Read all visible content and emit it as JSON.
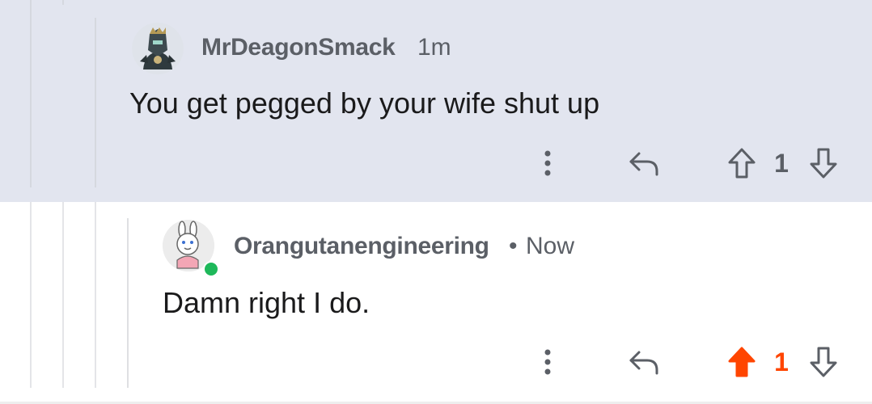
{
  "comments": [
    {
      "username": "MrDeagonSmack",
      "time": "1m",
      "body": "You get pegged by your wife shut up",
      "score": "1",
      "upvoted": false,
      "avatar_icon": "knight-avatar-icon"
    },
    {
      "username": "Orangutanengineering",
      "separator": "•",
      "time": "Now",
      "body": "Damn right I do.",
      "score": "1",
      "upvoted": true,
      "online": true,
      "avatar_icon": "bunny-avatar-icon"
    }
  ],
  "colors": {
    "highlight_bg": "#e2e5ef",
    "upvote_orange": "#ff4500",
    "meta_gray": "#5b5f66",
    "online_green": "#1eb85a"
  },
  "icons": [
    "more-options-icon",
    "reply-icon",
    "upvote-icon",
    "downvote-icon"
  ]
}
